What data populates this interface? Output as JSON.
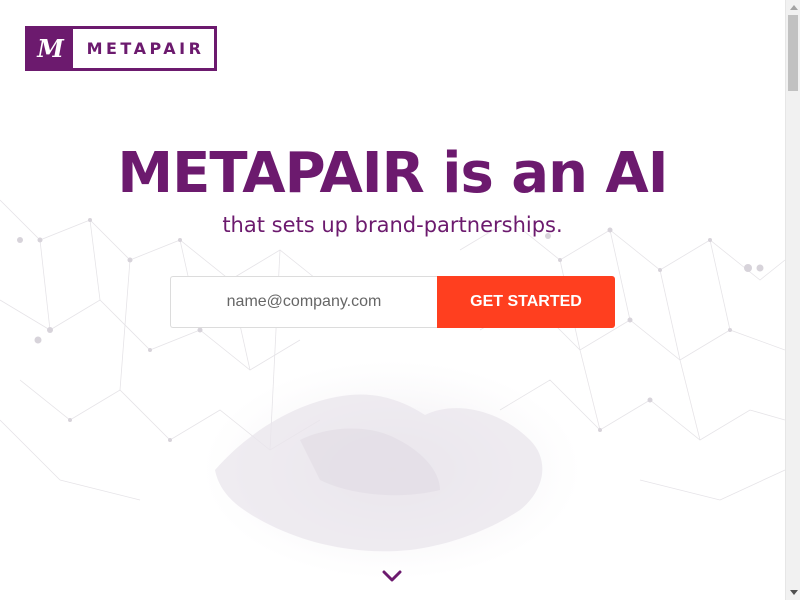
{
  "brand": {
    "logo_mark": "M",
    "logo_text": "METAPAIR",
    "primary_color": "#6c1a6e",
    "accent_color": "#ff3f1f"
  },
  "hero": {
    "title": "METAPAIR is an AI",
    "subtitle": "that sets up brand-partnerships."
  },
  "signup": {
    "email_value": "",
    "email_placeholder": "name@company.com",
    "cta_label": "GET STARTED"
  },
  "icons": {
    "scroll_down": "chevron-down-icon",
    "background": "network-handshake-illustration"
  }
}
